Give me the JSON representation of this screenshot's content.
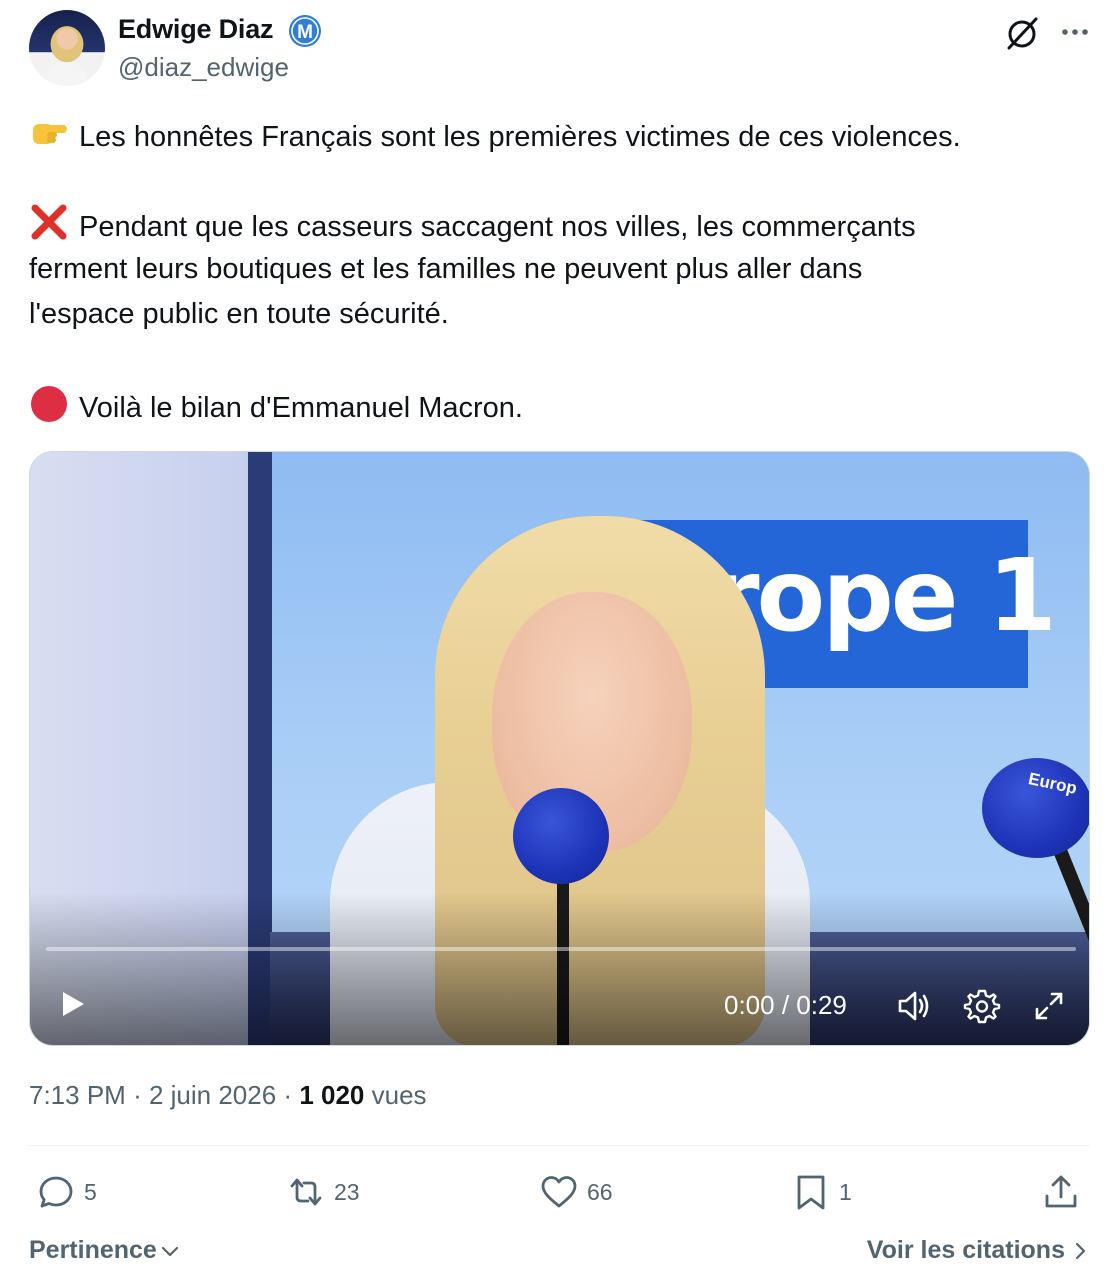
{
  "author": {
    "name": "Edwige Diaz",
    "handle": "@diaz_edwige",
    "badge_letter": "M"
  },
  "post": {
    "line1": "Les honnêtes Français sont les premières victimes de ces violences.",
    "line2a": "Pendant que les casseurs saccagent nos villes, les commerçants",
    "line2b": "ferment leurs boutiques et les familles ne peuvent plus aller dans",
    "line2c": "l'espace public en toute sécurité.",
    "line3": "Voilà le bilan d'Emmanuel Macron.",
    "emojis": [
      "pointing-right-emoji",
      "cross-mark-emoji",
      "red-circle-emoji"
    ]
  },
  "video": {
    "logo_text": "urope 1",
    "mic_label": "Europ",
    "timecode": "0:00 / 0:29",
    "progress": 0
  },
  "meta": {
    "time": "7:13 PM",
    "date": "2 juin 2026",
    "views_count": "1 020",
    "views_label": "vues"
  },
  "actions": {
    "replies": "5",
    "reposts": "23",
    "likes": "66",
    "bookmarks": "1"
  },
  "footer": {
    "sort_label": "Pertinence",
    "quotes_label": "Voir les citations"
  },
  "colors": {
    "text": "#0f1419",
    "secondary": "#536471",
    "badge_blue": "#1d9bf0",
    "europe1_blue": "#2466d7"
  }
}
